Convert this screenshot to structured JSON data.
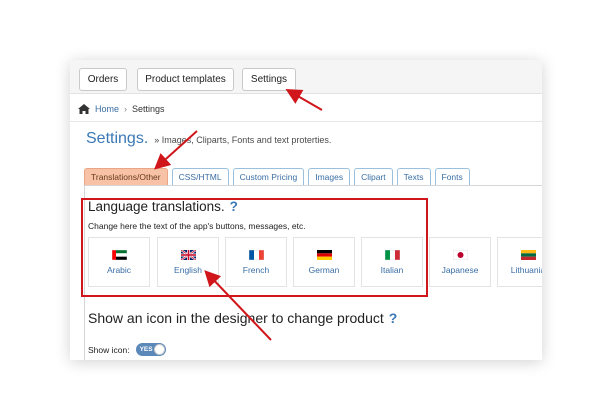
{
  "topnav": {
    "orders": "Orders",
    "product_templates": "Product templates",
    "settings": "Settings"
  },
  "breadcrumb": {
    "home": "Home",
    "sep": "›",
    "current": "Settings"
  },
  "page": {
    "title": "Settings.",
    "subtitle": "» Images, Cliparts, Fonts and text proterties."
  },
  "tabs": [
    "Translations/Other",
    "CSS/HTML",
    "Custom Pricing",
    "Images",
    "Clipart",
    "Texts",
    "Fonts"
  ],
  "translations": {
    "title": "Language translations.",
    "help": "?",
    "description": "Change here the text of the app's buttons, messages, etc.",
    "languages": [
      {
        "name": "Arabic",
        "flag": "uae-flag"
      },
      {
        "name": "English",
        "flag": "uk-flag"
      },
      {
        "name": "French",
        "flag": "france-flag"
      },
      {
        "name": "German",
        "flag": "germany-flag"
      },
      {
        "name": "Italian",
        "flag": "italy-flag"
      },
      {
        "name": "Japanese",
        "flag": "japan-flag"
      },
      {
        "name": "Lithuania",
        "flag": "lithuania-flag"
      }
    ]
  },
  "show_icon": {
    "title": "Show an icon in the designer to change product",
    "help": "?",
    "label": "Show icon:",
    "toggle": "YES"
  },
  "colors": {
    "accent": "#3a78b5",
    "active_tab": "#f7c2a6",
    "highlight": "#d0161b",
    "toggle": "#5a88b8"
  }
}
